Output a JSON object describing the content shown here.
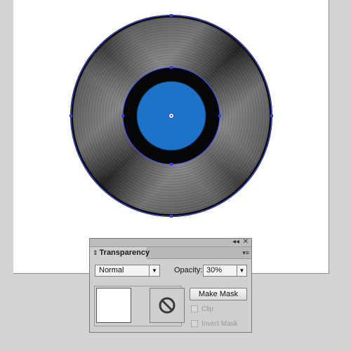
{
  "canvas": {
    "artwork": "vinyl-record",
    "label_color": "#1e73c8",
    "selection_color": "#4455ff"
  },
  "panel": {
    "collapse_glyph": "◂◂",
    "close_glyph": "✕",
    "tab_updown_glyph": "⇕",
    "tab_title": "Transparency",
    "menu_glyph": "▾≡",
    "blend_mode": "Normal",
    "dropdown_glyph": "▼",
    "opacity_label": "Opacity:",
    "opacity_value": "30%",
    "make_mask_label": "Make Mask",
    "clip_label": "Clip",
    "invert_mask_label": "Invert Mask",
    "clip_checked": false,
    "invert_mask_checked": false
  }
}
